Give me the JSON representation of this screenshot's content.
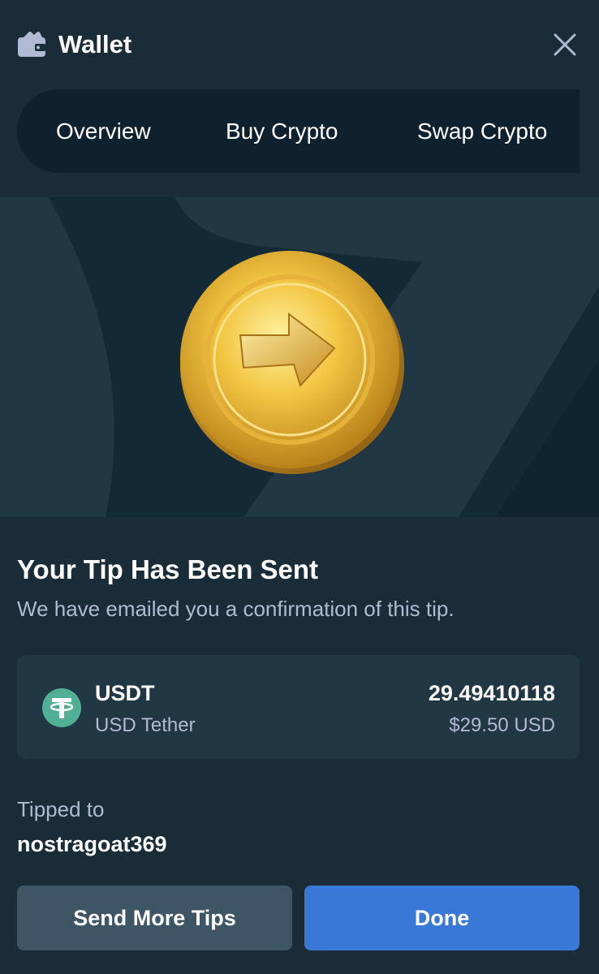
{
  "header": {
    "title": "Wallet",
    "wallet_icon": "wallet-icon",
    "close_icon": "close-icon"
  },
  "tabs": [
    {
      "label": "Overview"
    },
    {
      "label": "Buy Crypto"
    },
    {
      "label": "Swap Crypto"
    }
  ],
  "hero": {
    "image": "gold-coin-send-arrow-icon"
  },
  "confirmation": {
    "title": "Your Tip Has Been Sent",
    "subtitle": "We have emailed you a confirmation of this tip."
  },
  "token": {
    "symbol": "USDT",
    "name": "USD Tether",
    "amount": "29.49410118",
    "usd_value": "$29.50 USD",
    "icon": "tether-icon",
    "icon_color": "#50af95"
  },
  "tip": {
    "label": "Tipped to",
    "recipient": "nostragoat369"
  },
  "buttons": {
    "send_more": "Send More Tips",
    "done": "Done"
  },
  "colors": {
    "background": "#1a2c38",
    "tabs_background": "#0f212e",
    "card_background": "#213743",
    "primary_button": "#3a78d8",
    "secondary_button": "#3d5564",
    "muted_text": "#b1bad3"
  }
}
